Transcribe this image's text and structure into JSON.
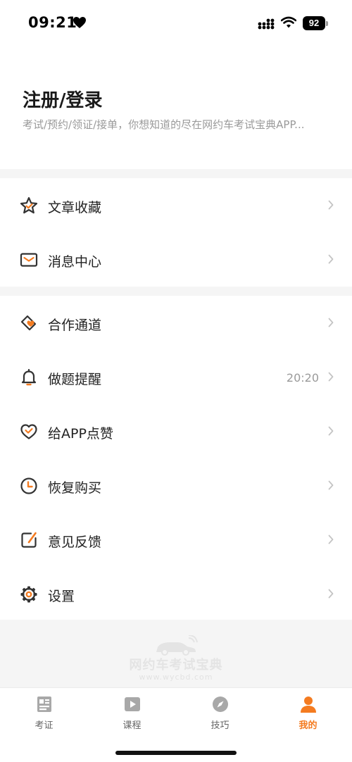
{
  "status_bar": {
    "time": "09:21",
    "battery": "92"
  },
  "header": {
    "title": "注册/登录",
    "subtitle": "考试/预约/领证/接单，你想知道的尽在网约车考试宝典APP..."
  },
  "menu_groups": [
    {
      "items": [
        {
          "label": "文章收藏",
          "icon": "star-icon"
        },
        {
          "label": "消息中心",
          "icon": "envelope-icon"
        }
      ]
    },
    {
      "items": [
        {
          "label": "合作通道",
          "icon": "handshake-heart-icon"
        },
        {
          "label": "做题提醒",
          "icon": "bell-icon",
          "value": "20:20"
        },
        {
          "label": "给APP点赞",
          "icon": "heart-thumb-icon"
        },
        {
          "label": "恢复购买",
          "icon": "clock-icon"
        },
        {
          "label": "意见反馈",
          "icon": "feedback-pen-icon"
        },
        {
          "label": "设置",
          "icon": "gear-icon"
        }
      ]
    }
  ],
  "watermark": {
    "title": "网约车考试宝典",
    "url": "www.wycbd.com"
  },
  "tab_bar": {
    "tabs": [
      {
        "label": "考证",
        "icon": "exam-book-icon",
        "active": false
      },
      {
        "label": "课程",
        "icon": "video-play-icon",
        "active": false
      },
      {
        "label": "技巧",
        "icon": "compass-icon",
        "active": false
      },
      {
        "label": "我的",
        "icon": "user-icon",
        "active": true
      }
    ]
  },
  "colors": {
    "accent": "#f47b20",
    "icon_dark": "#333333",
    "gap_bg": "#f5f5f5"
  }
}
